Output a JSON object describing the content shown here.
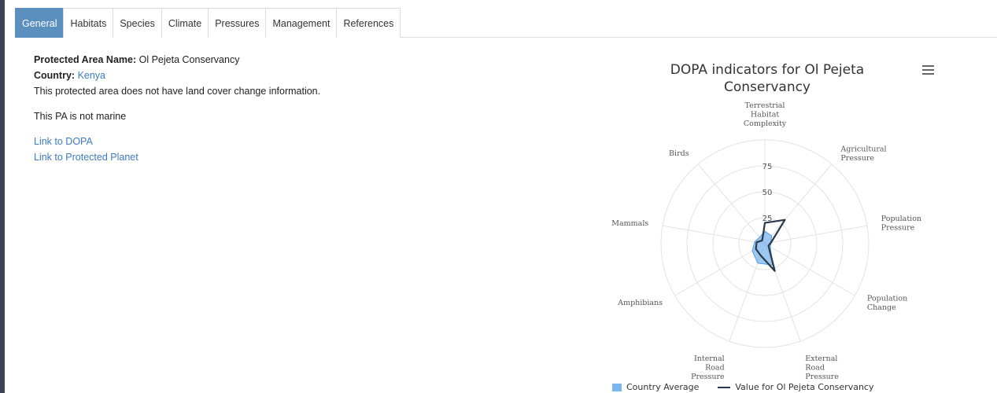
{
  "tabs": [
    {
      "label": "General",
      "active": true
    },
    {
      "label": "Habitats"
    },
    {
      "label": "Species"
    },
    {
      "label": "Climate"
    },
    {
      "label": "Pressures"
    },
    {
      "label": "Management"
    },
    {
      "label": "References"
    }
  ],
  "general": {
    "pa_name_label": "Protected Area Name:",
    "pa_name_value": "Ol Pejeta Conservancy",
    "country_label": "Country:",
    "country_value": "Kenya",
    "land_cover_text": "This protected area does not have land cover change information.",
    "marine_text": "This PA is not marine",
    "link_dopa": "Link to DOPA",
    "link_protected_planet": "Link to Protected Planet"
  },
  "colors": {
    "accent": "#5b8fbd",
    "link": "#3c7bbf",
    "country_average": "#7cb5ec",
    "value_line": "#2a3a4a"
  },
  "chart_data": {
    "type": "radar",
    "title": "DOPA indicators for Ol Pejeta Conservancy",
    "title_lines": [
      "DOPA indicators for Ol Pejeta",
      "Conservancy"
    ],
    "categories": [
      [
        "Terrestrial",
        "Habitat",
        "Complexity"
      ],
      [
        "Agricultural",
        "Pressure"
      ],
      [
        "Population",
        "Pressure"
      ],
      [
        "Population",
        "Change"
      ],
      [
        "External",
        "Road",
        "Pressure"
      ],
      [
        "Internal",
        "Road",
        "Pressure"
      ],
      [
        "Amphibians"
      ],
      [
        "Mammals"
      ],
      [
        "Birds"
      ]
    ],
    "y_ticks": [
      25,
      50,
      75
    ],
    "y_max": 100,
    "series": [
      {
        "name": "Country Average",
        "type": "area",
        "values": [
          12,
          10,
          6,
          6,
          22,
          20,
          14,
          10,
          8
        ]
      },
      {
        "name": "Value for Ol Pejeta Conservancy",
        "type": "line",
        "values": [
          20,
          30,
          6,
          4,
          28,
          12,
          10,
          8,
          4
        ]
      }
    ],
    "legend_position": "bottom"
  }
}
